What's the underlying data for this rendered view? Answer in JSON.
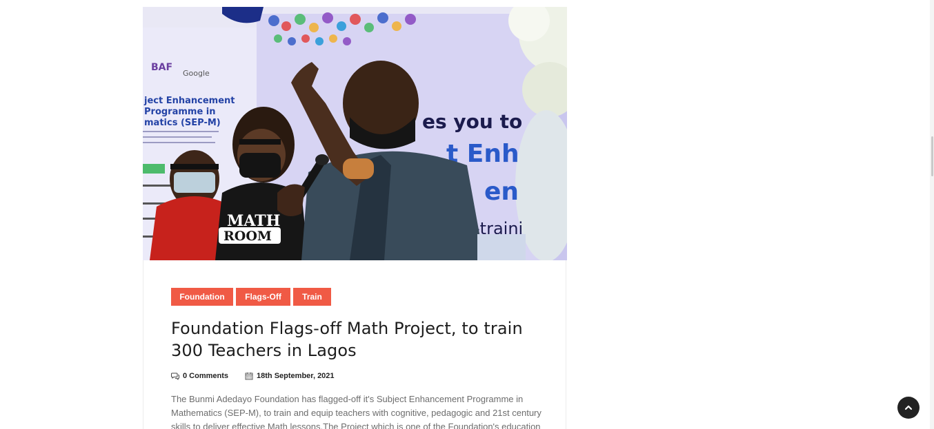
{
  "post": {
    "image_alt": "Foundation Flags-off Math Project",
    "categories": [
      {
        "label": "Foundation"
      },
      {
        "label": "Flags-Off"
      },
      {
        "label": "Train"
      }
    ],
    "title": "Foundation Flags-off Math Project, to train 300 Teachers in Lagos",
    "comments": "0 Comments",
    "date": "18th September, 2021",
    "excerpt": "The Bunmi Adedayo Foundation has flagged-off it's Subject Enhancement Programme in Mathematics (SEP-M), to train and equip teachers with cognitive, pedagogic and 21st century skills to deliver effective Math lessons.The Project which is one of the Foundation's education",
    "banner_text": {
      "org": "BAF",
      "partner": "Google",
      "program_line1": "ject Enhancement",
      "program_line2": "Programme in",
      "program_line3": "matics (SEP-M)",
      "shirt_line1": "MATH",
      "shirt_line2": "ROOM",
      "backdrop_line1": "es you to",
      "backdrop_line2": "t Enh",
      "backdrop_line3": "en",
      "backdrop_line4": "-traini"
    }
  },
  "icons": {
    "comment": "comment-icon",
    "calendar": "calendar-icon",
    "back_to_top": "chevron-up-icon"
  },
  "colors": {
    "tag_bg": "#f05a45",
    "back_to_top_bg": "#222222"
  }
}
